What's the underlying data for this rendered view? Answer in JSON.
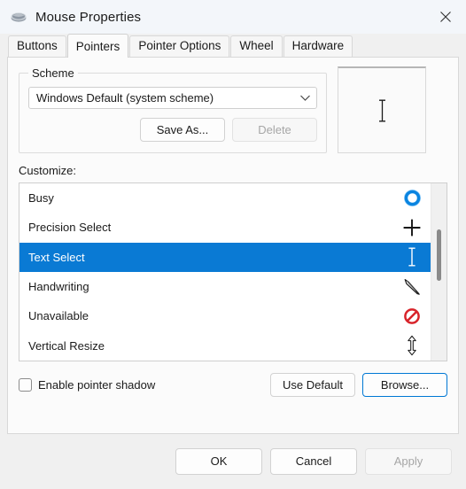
{
  "window": {
    "title": "Mouse Properties",
    "icon": "mouse-icon",
    "close_icon": "close-icon"
  },
  "tabs": [
    {
      "label": "Buttons",
      "active": false
    },
    {
      "label": "Pointers",
      "active": true
    },
    {
      "label": "Pointer Options",
      "active": false
    },
    {
      "label": "Wheel",
      "active": false
    },
    {
      "label": "Hardware",
      "active": false
    }
  ],
  "scheme": {
    "legend": "Scheme",
    "combo_value": "Windows Default (system scheme)",
    "combo_icon": "chevron-down-icon",
    "save_as_label": "Save As...",
    "delete_label": "Delete",
    "delete_disabled": true
  },
  "preview": {
    "cursor_icon": "text-select-ibeam-icon"
  },
  "customize": {
    "label": "Customize:",
    "items": [
      {
        "label": "Busy",
        "icon": "busy-ring-icon",
        "selected": false
      },
      {
        "label": "Precision Select",
        "icon": "precision-crosshair-icon",
        "selected": false
      },
      {
        "label": "Text Select",
        "icon": "text-select-ibeam-icon",
        "selected": true
      },
      {
        "label": "Handwriting",
        "icon": "handwriting-pen-icon",
        "selected": false
      },
      {
        "label": "Unavailable",
        "icon": "unavailable-no-entry-icon",
        "selected": false
      },
      {
        "label": "Vertical Resize",
        "icon": "vertical-resize-arrow-icon",
        "selected": false
      }
    ],
    "scrollbar_icon": "vertical-scrollbar"
  },
  "options": {
    "pointer_shadow_label": "Enable pointer shadow",
    "pointer_shadow_checked": false,
    "use_default_label": "Use Default",
    "browse_label": "Browse...",
    "browse_focused": true
  },
  "footer": {
    "ok_label": "OK",
    "cancel_label": "Cancel",
    "apply_label": "Apply",
    "apply_disabled": true
  },
  "colors": {
    "accent": "#0078d4",
    "selection": "#0a7ad4",
    "window_bg": "#f0f0f0",
    "panel_bg": "#fbfbfb",
    "unavailable_red": "#d8232a"
  }
}
